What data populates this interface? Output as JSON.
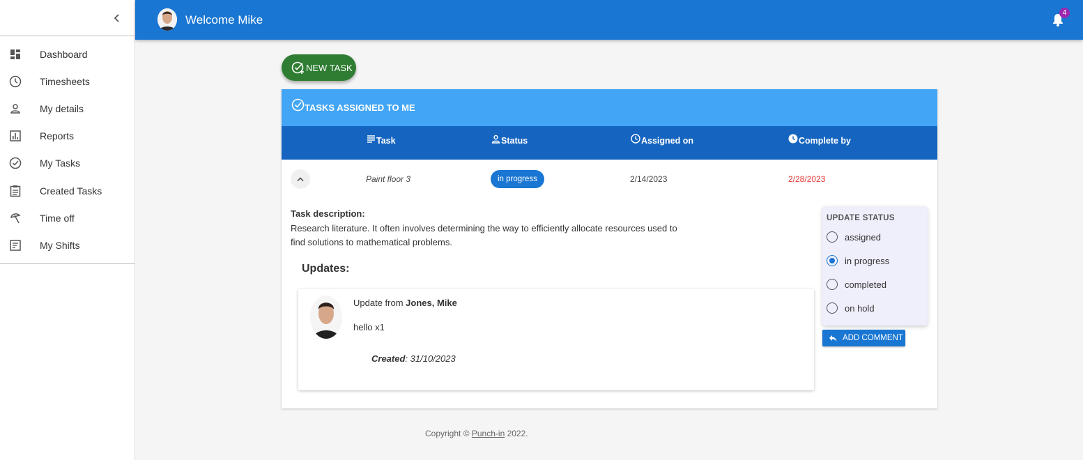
{
  "header": {
    "welcome": "Welcome Mike",
    "notification_count": "4"
  },
  "sidebar": {
    "items": [
      {
        "label": "Dashboard",
        "icon": "dashboard-icon"
      },
      {
        "label": "Timesheets",
        "icon": "clock-icon"
      },
      {
        "label": "My details",
        "icon": "person-icon"
      },
      {
        "label": "Reports",
        "icon": "bar-chart-icon"
      },
      {
        "label": "My Tasks",
        "icon": "check-circle-icon"
      },
      {
        "label": "Created Tasks",
        "icon": "clipboard-icon"
      },
      {
        "label": "Time off",
        "icon": "beach-icon"
      },
      {
        "label": "My Shifts",
        "icon": "list-icon"
      }
    ]
  },
  "new_task_label": "NEW TASK",
  "card": {
    "title": "TASKS ASSIGNED TO ME",
    "columns": {
      "task": "Task",
      "status": "Status",
      "assigned_on": "Assigned on",
      "complete_by": "Complete by"
    },
    "row": {
      "task": "Paint floor 3",
      "status": "in progress",
      "assigned_on": "2/14/2023",
      "complete_by": "2/28/2023"
    },
    "description_label": "Task description:",
    "description": "Research literature. It often involves determining the way to efficiently allocate resources used to find solutions to mathematical problems.",
    "updates_title": "Updates:",
    "update": {
      "from_prefix": "Update from",
      "author": "Jones, Mike",
      "message": "hello x1",
      "created_label": "Created",
      "created_date": ": 31/10/2023"
    },
    "status_panel": {
      "title": "UPDATE STATUS",
      "options": [
        "assigned",
        "in progress",
        "completed",
        "on hold"
      ],
      "selected": "in progress"
    },
    "add_comment_label": "ADD COMMENT"
  },
  "footer": {
    "prefix": "Copyright © ",
    "link": "Punch-in",
    "suffix": " 2022."
  },
  "colors": {
    "primary": "#1976d2",
    "header_blue": "#42a5f5",
    "table_head": "#1565c0",
    "green": "#2e7d32",
    "overdue": "#e53935",
    "badge": "#9c27b0"
  }
}
